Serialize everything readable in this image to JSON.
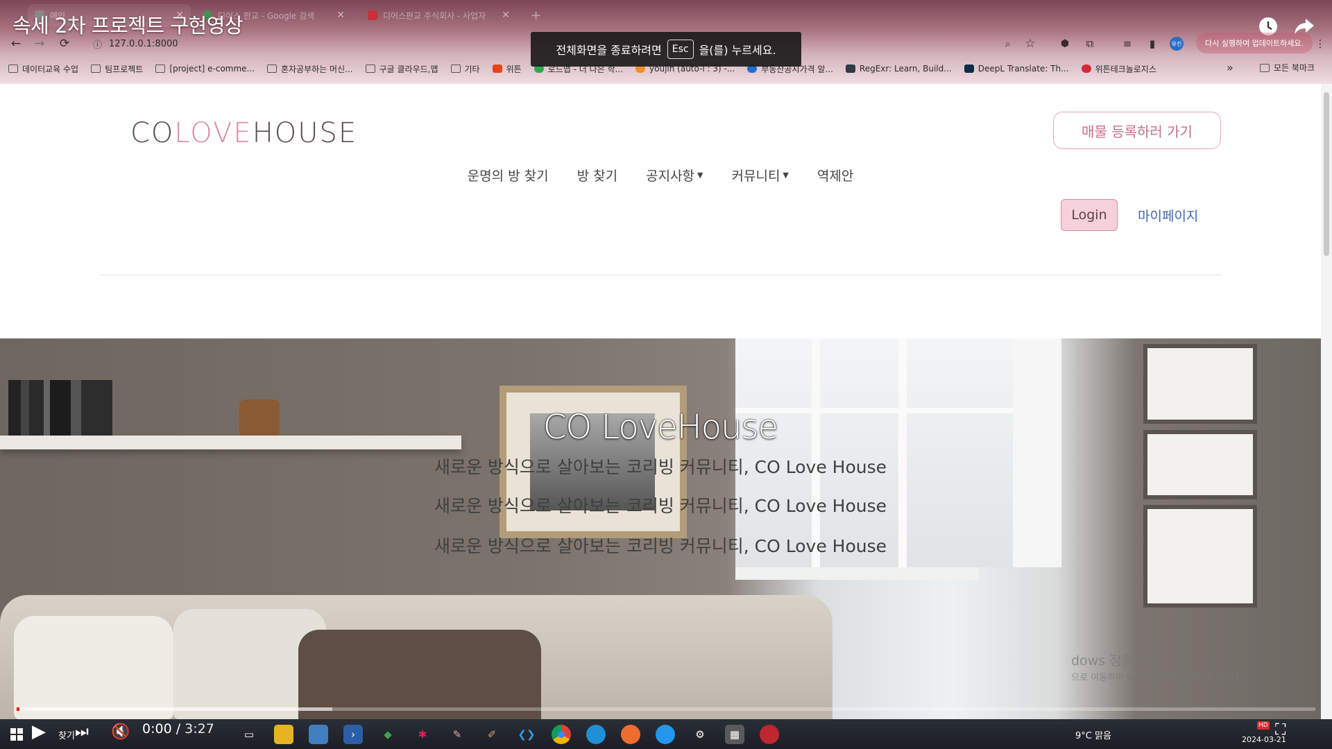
{
  "video": {
    "title": "속세 2차 프로젝트 구현영상",
    "time_current": "0:00",
    "time_separator": " / ",
    "time_total": "3:27",
    "progress_played": 0.002,
    "progress_buffered": 0.243
  },
  "browser": {
    "tabs": [
      {
        "label": "메인",
        "active": true
      },
      {
        "label": "디어스 판교 - Google 검색",
        "active": false
      },
      {
        "label": "디어스판교 주식회사 - 사업자",
        "active": false
      }
    ],
    "new_tab": "+",
    "url": "127.0.0.1:8000",
    "update_label": "다시 실행하여 업데이트하세요.",
    "profile": "유진",
    "fullscreen_toast": {
      "before": "전체화면을 종료하려면",
      "key": "Esc",
      "after": "을(를) 누르세요."
    },
    "bookmarks": [
      {
        "label": "데이터교육 수업",
        "type": "folder"
      },
      {
        "label": "팀프로젝트",
        "type": "folder"
      },
      {
        "label": "[project] e-comme...",
        "type": "folder"
      },
      {
        "label": "혼자공부하는 머신...",
        "type": "folder"
      },
      {
        "label": "구글 클라우드,맵",
        "type": "folder"
      },
      {
        "label": "기타",
        "type": "folder"
      },
      {
        "label": "위튼",
        "type": "site",
        "color": "#e4451a"
      },
      {
        "label": "로드맵 - 더 나은 학...",
        "type": "site",
        "color": "#2fa84f"
      },
      {
        "label": "youjin (auto-l : 3) -...",
        "type": "site",
        "color": "#f28c28"
      },
      {
        "label": "부동산공시가격 알...",
        "type": "site",
        "color": "#1f6fd0"
      },
      {
        "label": "RegExr: Learn, Build...",
        "type": "site",
        "color": "#2d3b45"
      },
      {
        "label": "DeepL Translate: Th...",
        "type": "site",
        "color": "#0f2b46"
      },
      {
        "label": "위튼테크놀로지스",
        "type": "site",
        "color": "#d12a3a"
      }
    ],
    "bookmarks_more": "»",
    "bookmarks_all": "모든 북마크"
  },
  "site": {
    "logo": {
      "part1": "CO",
      "part2": "LOVE",
      "part3": "HOUSE"
    },
    "register_button": "매물 등록하러 가기",
    "nav": [
      {
        "label": "운명의 방 찾기",
        "dropdown": false
      },
      {
        "label": "방 찾기",
        "dropdown": false
      },
      {
        "label": "공지사항",
        "dropdown": true
      },
      {
        "label": "커뮤니티",
        "dropdown": true
      },
      {
        "label": "역제안",
        "dropdown": false
      }
    ],
    "login_button": "Login",
    "mypage_link": "마이페이지",
    "hero": {
      "title": "CO LoveHouse",
      "lines": [
        "새로운 방식으로 살아보는 코리빙 커뮤니티, CO Love House",
        "새로운 방식으로 살아보는 코리빙 커뮤니티, CO Love House",
        "새로운 방식으로 살아보는 코리빙 커뮤니티, CO Love House"
      ]
    },
    "watermark": {
      "line1": "dows 정품 인증",
      "line2": "으로 이동하여 Windows를 정품 인증합니다."
    }
  },
  "taskbar": {
    "search_label": "찾기",
    "weather": "9°C  맑음",
    "date": "2024-03-21",
    "hd": "HD",
    "icons": [
      "windows-icon",
      "search-icon",
      "task-view-icon",
      "file-explorer-icon",
      "app-icon",
      "powershell-icon",
      "mongodb-icon",
      "slack-icon",
      "paint-icon",
      "tool-icon",
      "vscode-icon",
      "chrome-icon",
      "edge-icon",
      "postman-icon",
      "docker-icon",
      "settings-icon",
      "calculator-icon",
      "camera-icon"
    ]
  },
  "colors": {
    "brand_pink": "#d98aa3",
    "login_bg": "#f6d1da",
    "link_blue": "#3f66b2",
    "progress_red": "#ff0000"
  }
}
